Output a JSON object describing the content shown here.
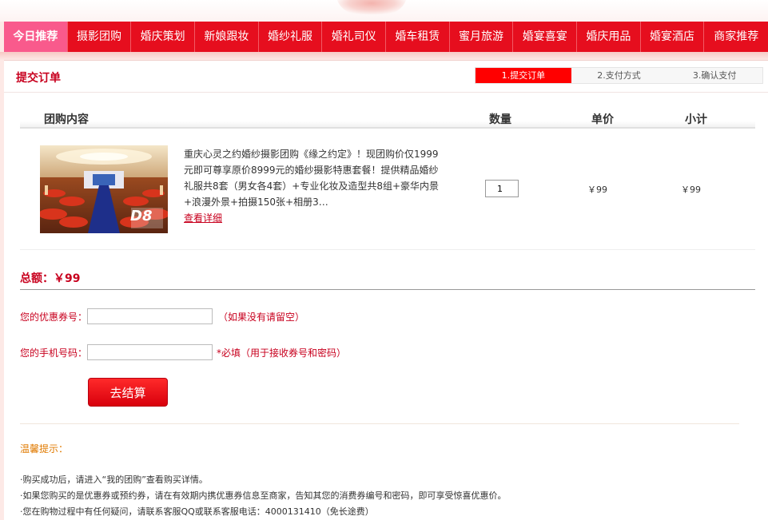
{
  "nav": {
    "items": [
      {
        "label": "今日推荐"
      },
      {
        "label": "摄影团购"
      },
      {
        "label": "婚庆策划"
      },
      {
        "label": "新娘跟妆"
      },
      {
        "label": "婚纱礼服"
      },
      {
        "label": "婚礼司仪"
      },
      {
        "label": "婚车租赁"
      },
      {
        "label": "蜜月旅游"
      },
      {
        "label": "婚宴喜宴"
      },
      {
        "label": "婚庆用品"
      },
      {
        "label": "婚宴酒店"
      },
      {
        "label": "商家推荐"
      }
    ]
  },
  "order": {
    "title": "提交订单",
    "steps": [
      "1.提交订单",
      "2.支付方式",
      "3.确认支付"
    ]
  },
  "table": {
    "headers": {
      "content": "团购内容",
      "qty": "数量",
      "price": "单价",
      "subtotal": "小计"
    },
    "item": {
      "description": "重庆心灵之约婚纱摄影团购《缘之约定》！现团购价仅1999元即可尊享原价8999元的婚纱摄影特惠套餐！提供精品婚纱礼服共8套（男女各4套）+专业化妆及造型共8组+豪华内景+浪漫外景+拍摄150张+相册3…",
      "detail_link": "查看详细",
      "qty": "1",
      "price": "￥99",
      "subtotal": "￥99",
      "image_watermark": "D8"
    }
  },
  "summary": {
    "total": "总额：￥99"
  },
  "form": {
    "coupon_label": "您的优惠券号：",
    "coupon_hint": "（如果没有请留空）",
    "phone_label": "您的手机号码：",
    "phone_hint": "*必填（用于接收券号和密码）",
    "submit_label": "去结算"
  },
  "tips": {
    "title": "温馨提示：",
    "items": [
      "·购买成功后，请进入“我的团购”查看购买详情。",
      "·如果您购买的是优惠券或预约券，请在有效期内携优惠券信息至商家，告知其您的消费券编号和密码，即可享受惊喜优惠价。",
      "·您在购物过程中有任何疑问，请联系客服QQ或联系客服电话：4000131410（免长途费）"
    ]
  },
  "colors": {
    "nav_bg": "#e60e1e",
    "nav_active": "#f95a8c",
    "accent": "#c8001e",
    "tips_title": "#e07a00"
  }
}
